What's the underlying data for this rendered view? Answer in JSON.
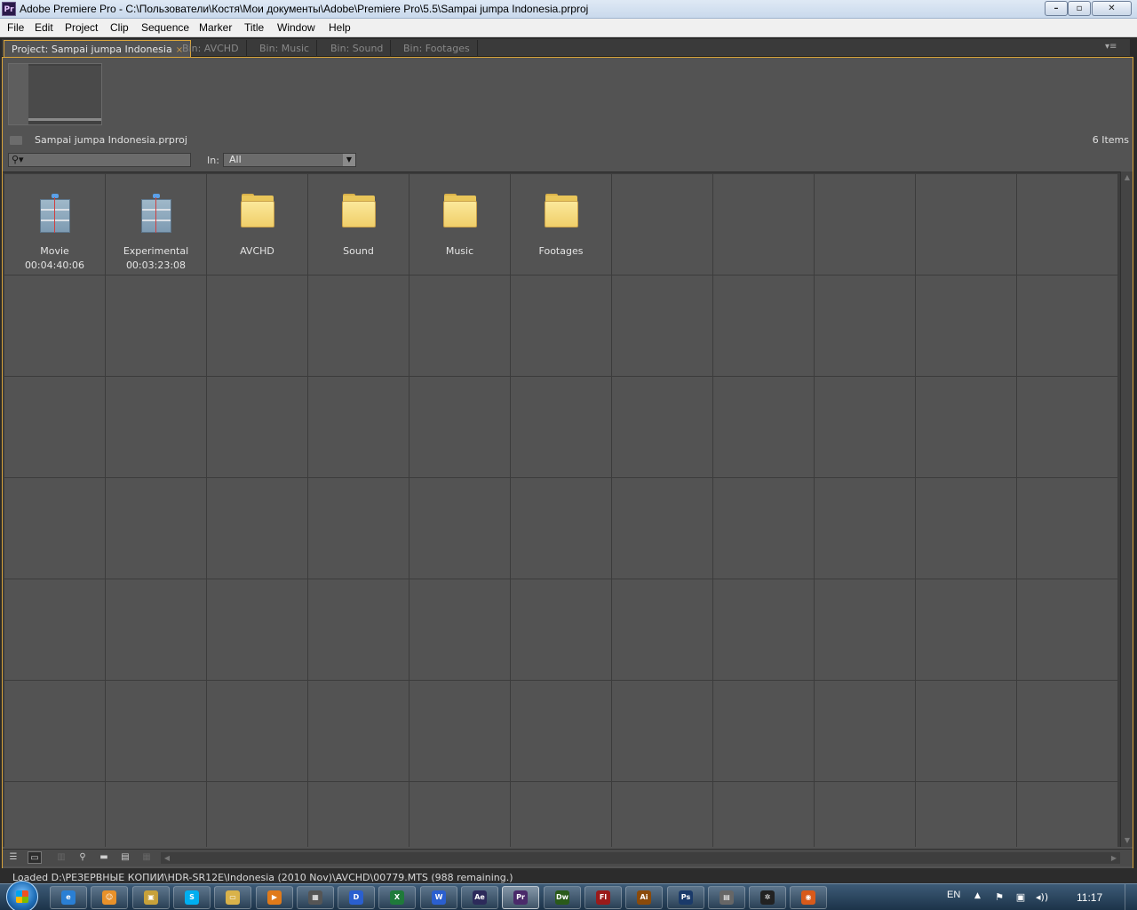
{
  "window": {
    "title": "Adobe Premiere Pro - C:\\Пользователи\\Костя\\Мои документы\\Adobe\\Premiere Pro\\5.5\\Sampai jumpa Indonesia.prproj",
    "app_badge": "Pr",
    "minimize": "–",
    "maximize": "▫",
    "close": "✕"
  },
  "menu": [
    "File",
    "Edit",
    "Project",
    "Clip",
    "Sequence",
    "Marker",
    "Title",
    "Window",
    "Help"
  ],
  "tabs": [
    {
      "label": "Project: Sampai jumpa Indonesia",
      "close": "×",
      "active": true
    },
    {
      "label": "Bin: AVCHD",
      "active": false
    },
    {
      "label": "Bin: Music",
      "active": false
    },
    {
      "label": "Bin: Sound",
      "active": false
    },
    {
      "label": "Bin: Footages",
      "active": false
    }
  ],
  "panel": {
    "project_file": "Sampai jumpa Indonesia.prproj",
    "item_count": "6 Items",
    "search": {
      "value": "",
      "placeholder": ""
    },
    "in_label": "In:",
    "in_value": "All"
  },
  "items": [
    {
      "type": "sequence",
      "name": "Movie",
      "duration": "00:04:40:06"
    },
    {
      "type": "sequence",
      "name": "Experimental",
      "duration": "00:03:23:08"
    },
    {
      "type": "folder",
      "name": "AVCHD"
    },
    {
      "type": "folder",
      "name": "Sound"
    },
    {
      "type": "folder",
      "name": "Music"
    },
    {
      "type": "folder",
      "name": "Footages"
    }
  ],
  "status_text": "Loaded D:\\РЕЗЕРВНЫЕ КОПИИ\\HDR-SR12E\\Indonesia (2010 Nov)\\AVCHD\\00779.MTS (988 remaining.)",
  "taskbar": {
    "apps": [
      {
        "name": "internet-explorer",
        "glyph": "e",
        "color": "#2a7fd4"
      },
      {
        "name": "firefox-like",
        "glyph": "☺",
        "color": "#e8912a"
      },
      {
        "name": "explorer-window",
        "glyph": "▣",
        "color": "#c7a13a"
      },
      {
        "name": "skype",
        "glyph": "S",
        "color": "#00aff0"
      },
      {
        "name": "folder",
        "glyph": "▭",
        "color": "#d9b24a"
      },
      {
        "name": "media-player",
        "glyph": "▶",
        "color": "#e07a1a"
      },
      {
        "name": "film-app",
        "glyph": "▦",
        "color": "#555555"
      },
      {
        "name": "daemon-tools",
        "glyph": "D",
        "color": "#2a5fcf"
      },
      {
        "name": "excel",
        "glyph": "X",
        "color": "#1f7a3a"
      },
      {
        "name": "word",
        "glyph": "W",
        "color": "#2a5fcf"
      },
      {
        "name": "after-effects",
        "glyph": "Ae",
        "color": "#2c2a5a"
      },
      {
        "name": "premiere-pro",
        "glyph": "Pr",
        "color": "#4a2a6a",
        "active": true
      },
      {
        "name": "dreamweaver",
        "glyph": "Dw",
        "color": "#2a5a1a"
      },
      {
        "name": "flash",
        "glyph": "Fl",
        "color": "#9a1a1a"
      },
      {
        "name": "illustrator",
        "glyph": "Ai",
        "color": "#8a4a0a"
      },
      {
        "name": "photoshop",
        "glyph": "Ps",
        "color": "#1a3a6a"
      },
      {
        "name": "archive-app",
        "glyph": "▤",
        "color": "#666666"
      },
      {
        "name": "network-app",
        "glyph": "✲",
        "color": "#222222"
      },
      {
        "name": "browser-orange",
        "glyph": "◉",
        "color": "#d85a1a"
      }
    ],
    "language": "EN",
    "clock": "11:17"
  }
}
